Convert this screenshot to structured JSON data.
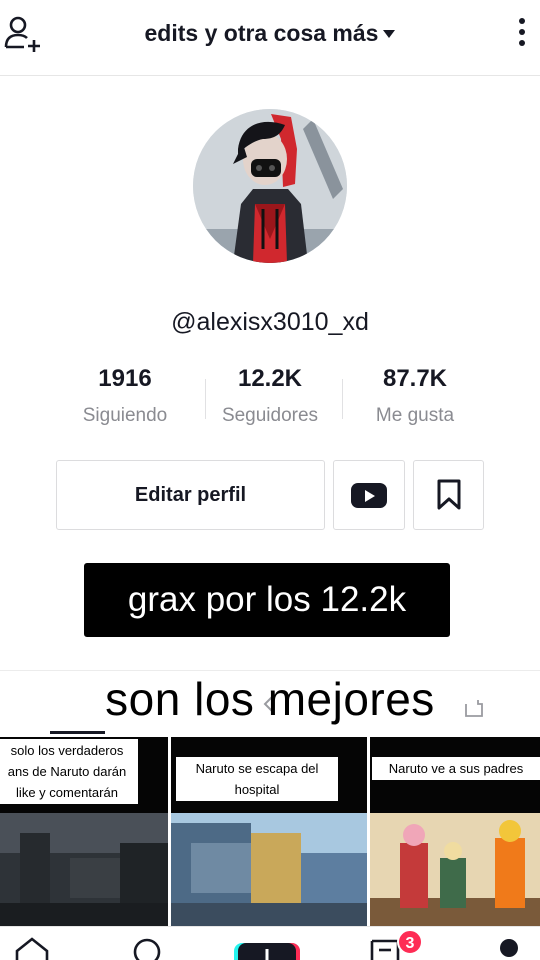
{
  "header": {
    "title": "edits y otra cosa más",
    "icons": {
      "left": "add-user-icon",
      "right": "more-vertical-icon"
    }
  },
  "profile": {
    "username": "@alexisx3010_xd",
    "stats": [
      {
        "value": "1916",
        "label": "Siguiendo"
      },
      {
        "value": "12.2K",
        "label": "Seguidores"
      },
      {
        "value": "87.7K",
        "label": "Me gusta"
      }
    ],
    "edit_button": "Editar perfil",
    "bio": "grax por los 12.2k"
  },
  "tabs": {
    "overlay_text": "son los mejores",
    "icons": [
      "grid-icon",
      "lock-icon",
      "private-icon"
    ]
  },
  "videos": [
    {
      "caption_lines": [
        "solo los verdaderos",
        "ans de Naruto darán",
        "like y comentarán"
      ]
    },
    {
      "caption_lines": [
        "Naruto se escapa del",
        "hospital"
      ]
    },
    {
      "caption_lines": [
        "Naruto ve a sus padres"
      ]
    }
  ],
  "bottom_nav": {
    "icons": [
      "home-icon",
      "discover-icon",
      "create-icon",
      "inbox-icon",
      "profile-icon"
    ],
    "inbox_badge": "3"
  },
  "colors": {
    "accent": "#fe2c55",
    "text": "#161823",
    "muted": "#8a8b91"
  }
}
